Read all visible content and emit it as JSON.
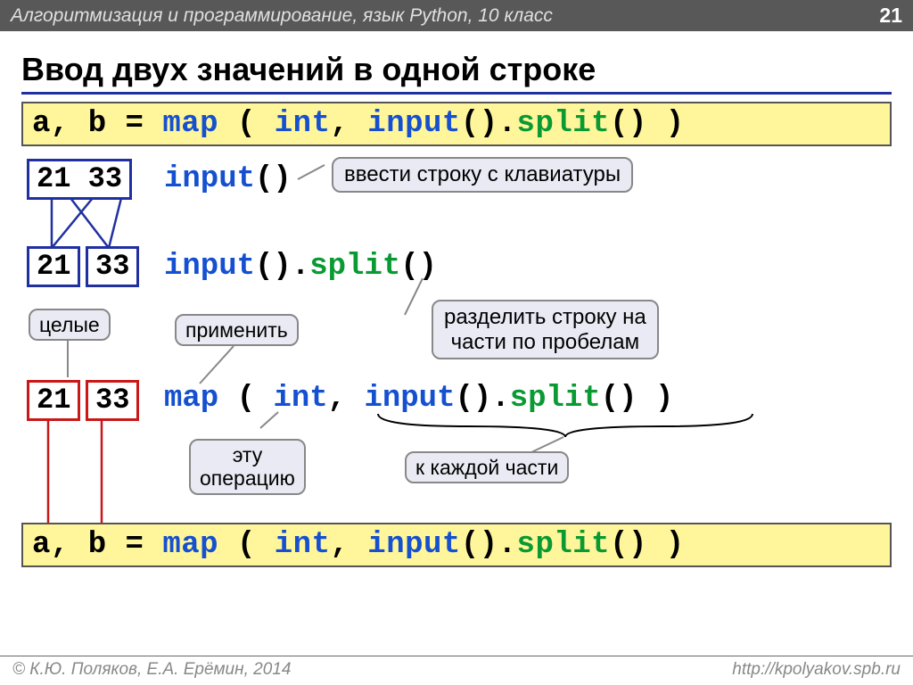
{
  "header": {
    "breadcrumb": "Алгоритмизация и программирование, язык Python, 10 класс",
    "page_number": "21"
  },
  "title": "Ввод двух значений в одной строке",
  "code_main_prefix": "a, b = ",
  "code_main_map": "map",
  "code_main_open": " ( ",
  "code_main_int": "int",
  "code_main_comma": ", ",
  "code_main_input": "input",
  "code_main_parens": "().",
  "code_main_split": "split",
  "code_main_tail": "() )",
  "box_2133": "21 33",
  "box_21": "21",
  "box_33": "33",
  "line_input": "input",
  "line_input_tail": "()",
  "line_split_input": "input",
  "line_split_mid": "().",
  "line_split_split": "split",
  "line_split_tail": "()",
  "line_map_map": "map",
  "line_map_open": " ( ",
  "line_map_int": "int",
  "line_map_comma": ", ",
  "line_map_input": "input",
  "line_map_mid": "().",
  "line_map_split": "split",
  "line_map_tail": "() )",
  "bubble_kbd": "ввести строку с клавиатуры",
  "bubble_splitdesc": "разделить строку на\nчасти по пробелам",
  "bubble_whole": "целые",
  "bubble_apply": "применить",
  "bubble_thisop": "эту\nоперацию",
  "bubble_eachpart": "к каждой части",
  "footer_left": "© К.Ю. Поляков, Е.А. Ерёмин, 2014",
  "footer_right": "http://kpolyakov.spb.ru"
}
